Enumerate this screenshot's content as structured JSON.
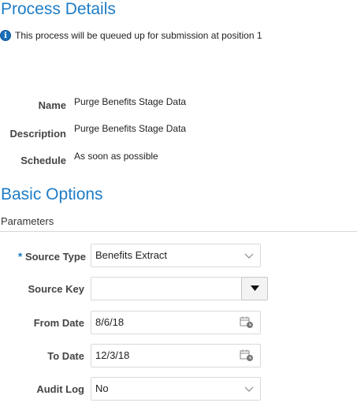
{
  "page": {
    "title": "Process Details"
  },
  "info": {
    "message": "This process will be queued up for submission at position 1",
    "icon": "info-icon"
  },
  "details": {
    "name_label": "Name",
    "name_value": "Purge Benefits Stage Data",
    "description_label": "Description",
    "description_value": "Purge Benefits Stage Data",
    "schedule_label": "Schedule",
    "schedule_value": "As soon as possible"
  },
  "basic_options": {
    "title": "Basic Options",
    "parameters_label": "Parameters"
  },
  "form": {
    "required_marker": "*",
    "source_type": {
      "label": "Source Type",
      "value": "Benefits Extract"
    },
    "source_key": {
      "label": "Source Key",
      "value": ""
    },
    "from_date": {
      "label": "From Date",
      "value": "8/6/18"
    },
    "to_date": {
      "label": "To Date",
      "value": "12/3/18"
    },
    "audit_log": {
      "label": "Audit Log",
      "value": "No"
    }
  },
  "colors": {
    "accent": "#1d7cc6",
    "info_icon": "#1a6fb8"
  }
}
